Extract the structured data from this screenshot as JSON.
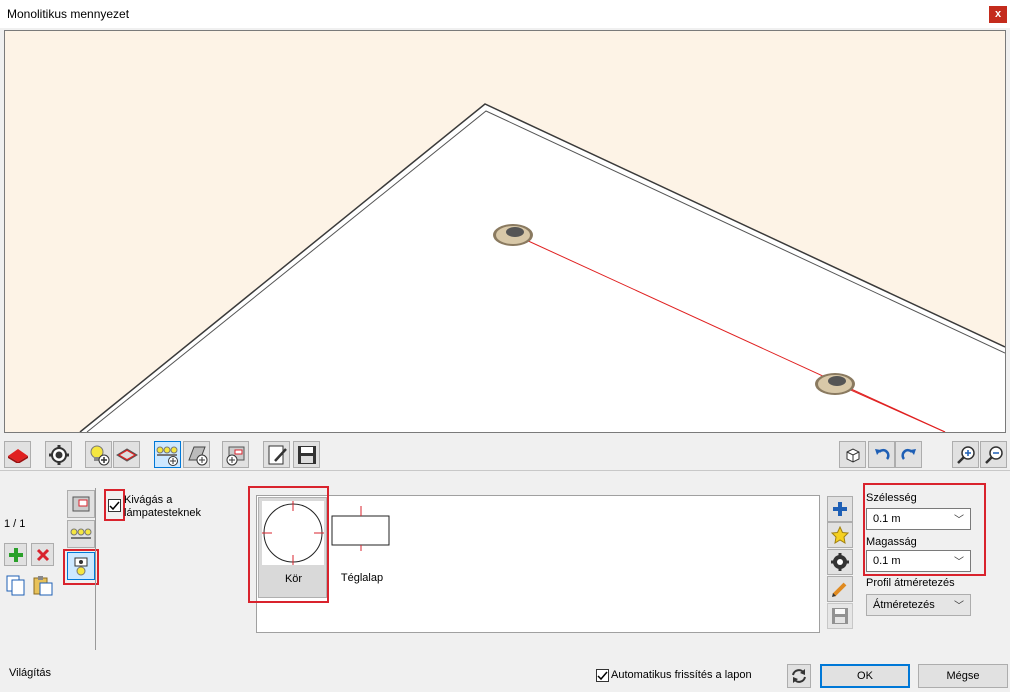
{
  "window": {
    "title": "Monolitikus mennyezet",
    "close_label": "x"
  },
  "toolbar": {
    "left_icons": [
      "slab-icon",
      "gear-icon",
      "light-add-icon",
      "slab-view-icon",
      "lamp-group-add-icon",
      "profile-add-icon",
      "opening-add-icon",
      "edit-document-icon",
      "save-icon"
    ],
    "right_icons": [
      "3d-box-icon",
      "undo-icon",
      "redo-icon",
      "zoom-in-icon",
      "zoom-out-icon"
    ]
  },
  "side_panel": {
    "counter": "1 / 1"
  },
  "cutout": {
    "checkbox_checked": true,
    "label_line1": "Kivágás a",
    "label_line2": "lámpatesteknek"
  },
  "shapes": [
    {
      "label": "Kör",
      "selected": true
    },
    {
      "label": "Téglalap",
      "selected": false
    }
  ],
  "dimensions": {
    "width_label": "Szélesség",
    "width_value": "0.1 m",
    "height_label": "Magasság",
    "height_value": "0.1 m",
    "profile_label": "Profil átméretezés",
    "profile_value": "Átméretezés"
  },
  "footer": {
    "status": "Világítás",
    "auto_refresh_checked": true,
    "auto_refresh_label": "Automatikus frissítés a lapon",
    "ok_label": "OK",
    "cancel_label": "Mégse"
  },
  "colors": {
    "accent_red": "#d9232d",
    "viewport_bg": "#fdf3e6",
    "focus_blue": "#0078d7"
  }
}
